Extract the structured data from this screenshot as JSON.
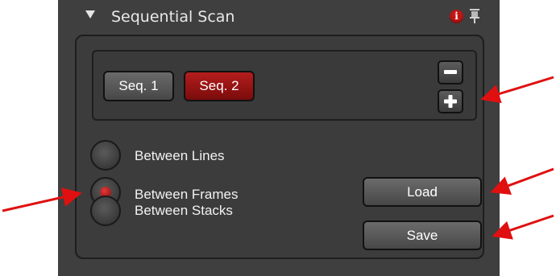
{
  "panel": {
    "title": "Sequential Scan",
    "info_icon": "info-icon",
    "info_glyph": "i",
    "pin_icon": "pin-icon",
    "colors": {
      "background": "#3f3f3f",
      "accent_red": "#9a1212",
      "annotation_arrow": "#e01010"
    }
  },
  "sequences": {
    "items": [
      {
        "label": "Seq. 1",
        "selected": false
      },
      {
        "label": "Seq. 2",
        "selected": true
      }
    ],
    "remove_icon": "minus-icon",
    "add_icon": "plus-icon"
  },
  "scan_mode": {
    "options": [
      {
        "label": "Between Lines",
        "selected": false
      },
      {
        "label": "Between Frames",
        "selected": true
      },
      {
        "label": "Between Stacks",
        "selected": false
      }
    ]
  },
  "actions": {
    "load_label": "Load",
    "save_label": "Save"
  }
}
